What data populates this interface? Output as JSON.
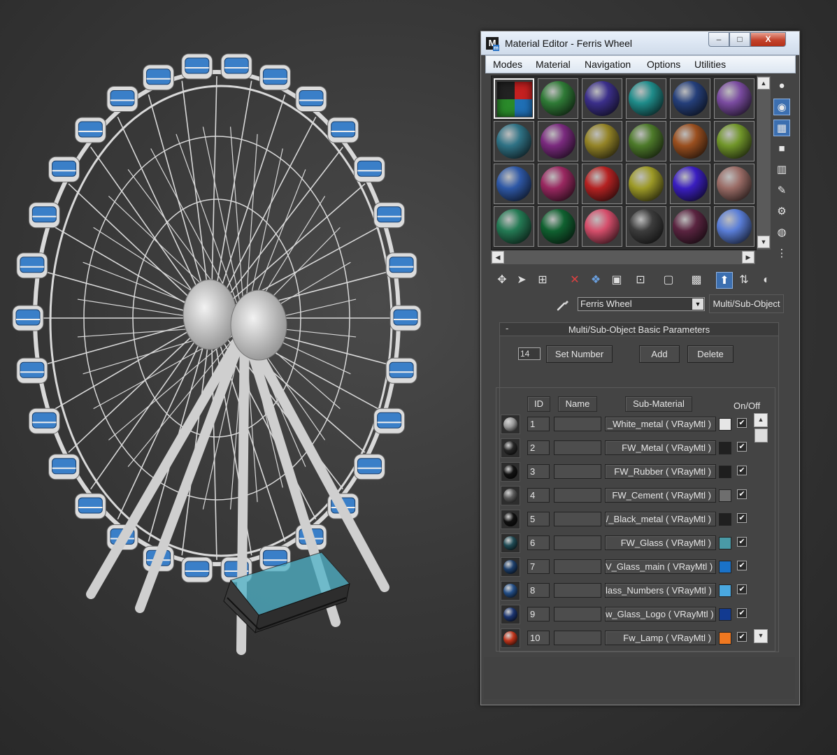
{
  "window": {
    "title": "Material Editor - Ferris Wheel",
    "icon_letter": "M",
    "icon_sub": "m"
  },
  "title_buttons": {
    "minimize": "–",
    "maximize": "□",
    "close": "X"
  },
  "menu": [
    "Modes",
    "Material",
    "Navigation",
    "Options",
    "Utilities"
  ],
  "slots": [
    "#multi",
    "#2f7a36",
    "#3b2f8a",
    "#1f8c8a",
    "#253f7a",
    "#7a4ba0",
    "#2f7285",
    "#7a2a7e",
    "#948427",
    "#4d7a2a",
    "#9a4f1f",
    "#71962a",
    "#2e58a6",
    "#992860",
    "#b52222",
    "#9d9a27",
    "#3a1ec0",
    "#9a6c66",
    "#247a54",
    "#106130",
    "#d54e6b",
    "#3c3c3c",
    "#5a2440",
    "#5a7ed8"
  ],
  "material": {
    "name": "Ferris Wheel",
    "type": "Multi/Sub-Object"
  },
  "rollout": {
    "title": "Multi/Sub-Object Basic Parameters",
    "collapse": "-",
    "count": "14",
    "set_number": "Set Number",
    "add": "Add",
    "delete": "Delete"
  },
  "columns": {
    "id": "ID",
    "name": "Name",
    "sub_material": "Sub-Material",
    "on_off": "On/Off"
  },
  "rows": [
    {
      "id": "1",
      "sub": "_White_metal  ( VRayMtl )",
      "swatch": "#e6e6e6",
      "orb": "#9a9a9a",
      "on": "✔"
    },
    {
      "id": "2",
      "sub": "FW_Metal  ( VRayMtl )",
      "swatch": "#202020",
      "orb": "#262626",
      "on": "✔"
    },
    {
      "id": "3",
      "sub": "FW_Rubber  ( VRayMtl )",
      "swatch": "#1e1e1e",
      "orb": "#121212",
      "on": "✔"
    },
    {
      "id": "4",
      "sub": "FW_Cement  ( VRayMtl )",
      "swatch": "#6e6e6e",
      "orb": "#5a5a5a",
      "on": "✔"
    },
    {
      "id": "5",
      "sub": "/_Black_metal  ( VRayMtl )",
      "swatch": "#1f1f1f",
      "orb": "#101010",
      "on": "✔"
    },
    {
      "id": "6",
      "sub": "FW_Glass  ( VRayMtl )",
      "swatch": "#4a9aa6",
      "orb": "#1f4b55",
      "on": "✔"
    },
    {
      "id": "7",
      "sub": "V_Glass_main  ( VRayMtl )",
      "swatch": "#1a72c8",
      "orb": "#1c3e6a",
      "on": "✔"
    },
    {
      "id": "8",
      "sub": "lass_Numbers  ( VRayMtl )",
      "swatch": "#4aa8e0",
      "orb": "#234e87",
      "on": "✔"
    },
    {
      "id": "9",
      "sub": "w_Glass_Logo  ( VRayMtl )",
      "swatch": "#123a90",
      "orb": "#1b3470",
      "on": "✔"
    },
    {
      "id": "10",
      "sub": "Fw_Lamp  ( VRayMtl )",
      "swatch": "#f07820",
      "orb": "#c0341a",
      "on": "✔"
    }
  ],
  "scroll": {
    "up": "▲",
    "down": "▼",
    "left": "◀",
    "right": "▶"
  },
  "icons": {
    "side_tools": [
      "sample-type-sphere-icon",
      "backlight-icon",
      "background-checker-icon",
      "sample-uv-tiling-icon",
      "video-color-check-icon",
      "make-preview-icon",
      "options-icon",
      "select-by-material-icon",
      "material-map-navigator-icon"
    ],
    "lower_tools": [
      "get-material-icon",
      "put-to-scene-icon",
      "assign-to-selection-icon",
      "reset-map-icon",
      "make-unique-icon",
      "put-to-library-icon",
      "material-id-channel-icon",
      "show-map-in-viewport-icon",
      "show-end-result-icon",
      "go-to-parent-icon",
      "go-forward-to-sibling-icon",
      "show-shaded-material-icon"
    ]
  }
}
